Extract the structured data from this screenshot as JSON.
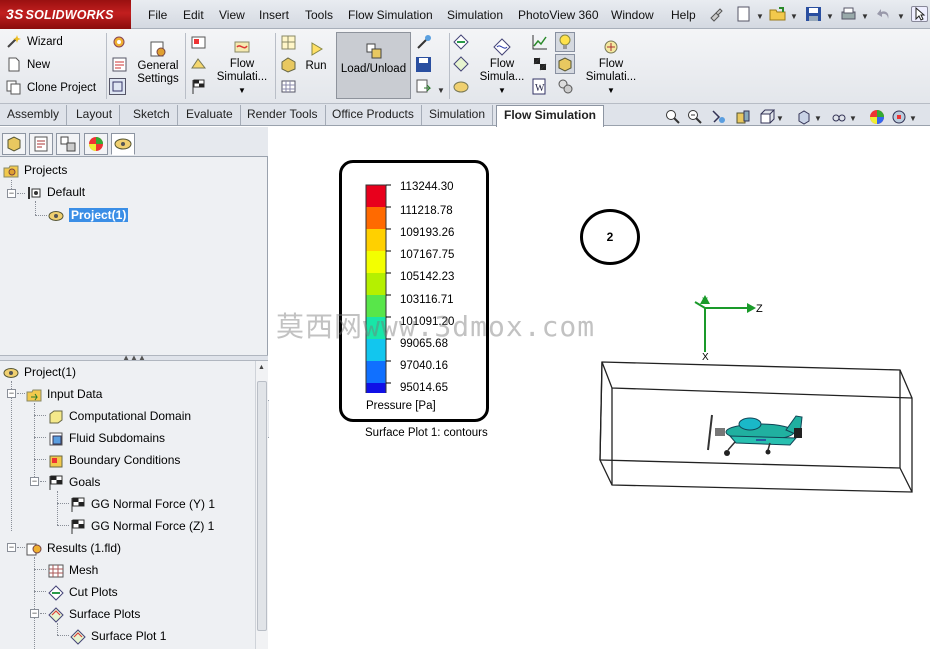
{
  "app": {
    "logo_prefix": "3S",
    "logo_text": "SOLIDWORKS"
  },
  "menu": [
    "File",
    "Edit",
    "View",
    "Insert",
    "Tools",
    "Flow Simulation",
    "Simulation",
    "PhotoView 360",
    "Window",
    "Help"
  ],
  "command_manager": {
    "wizard": "Wizard",
    "new": "New",
    "clone_project": "Clone Project",
    "general_settings_line1": "General",
    "general_settings_line2": "Settings",
    "flow_simulation_1_line1": "Flow",
    "flow_simulation_1_line2": "Simulati...",
    "run": "Run",
    "load_unload": "Load/Unload",
    "flow_simulation_2_line1": "Flow",
    "flow_simulation_2_line2": "Simula...",
    "flow_simulation_3_line1": "Flow",
    "flow_simulation_3_line2": "Simulati..."
  },
  "tabs": [
    {
      "label": "Assembly",
      "active": false
    },
    {
      "label": "Layout",
      "active": false
    },
    {
      "label": "Sketch",
      "active": false
    },
    {
      "label": "Evaluate",
      "active": false
    },
    {
      "label": "Render Tools",
      "active": false
    },
    {
      "label": "Office Products",
      "active": false
    },
    {
      "label": "Simulation",
      "active": false
    },
    {
      "label": "Flow Simulation",
      "active": true
    }
  ],
  "top_tree": {
    "projects": "Projects",
    "default": "Default",
    "project1": "Project(1)"
  },
  "analysis_tree": {
    "root": "Project(1)",
    "input_data": "Input Data",
    "computational_domain": "Computational Domain",
    "fluid_subdomains": "Fluid Subdomains",
    "boundary_conditions": "Boundary Conditions",
    "goals": "Goals",
    "goal_y": "GG Normal Force (Y) 1",
    "goal_z": "GG Normal Force (Z) 1",
    "results": "Results (1.fld)",
    "mesh": "Mesh",
    "cut_plots": "Cut Plots",
    "surface_plots": "Surface Plots",
    "surface_plot_1": "Surface Plot 1"
  },
  "legend": {
    "values": [
      "113244.30",
      "111218.78",
      "109193.26",
      "107167.75",
      "105142.23",
      "103116.71",
      "101091.20",
      "99065.68",
      "97040.16",
      "95014.65"
    ],
    "colors": [
      "#e8001c",
      "#ff6a00",
      "#ffd000",
      "#f3ff00",
      "#b5f000",
      "#58e64a",
      "#18e6a8",
      "#12c6ee",
      "#1070ff",
      "#1010e6"
    ],
    "title": "Pressure [Pa]",
    "caption": "Surface Plot 1: contours"
  },
  "callout": "2",
  "axes": {
    "y_label": "Y",
    "z_label": "Z",
    "x_label": "X"
  },
  "watermark": "莫西网www.3dmox.com"
}
